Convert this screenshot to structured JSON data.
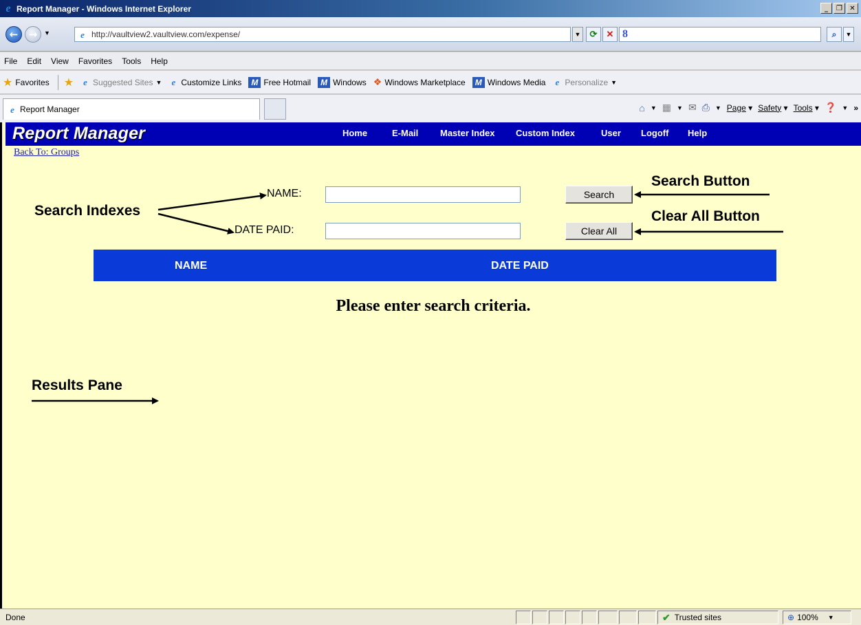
{
  "window": {
    "title": "Report Manager - Windows Internet Explorer",
    "controls": [
      "_",
      "ʕ",
      "X"
    ]
  },
  "address": {
    "url": "http://vaultview2.vaultview.com/expense/",
    "search_value": "8"
  },
  "menu": [
    "File",
    "Edit",
    "View",
    "Favorites",
    "Tools",
    "Help"
  ],
  "favorites": {
    "label": "Favorites",
    "items": [
      {
        "label": "Suggested Sites",
        "icon": "ie-icon",
        "muted": true,
        "dropdown": true
      },
      {
        "label": "Customize Links",
        "icon": "ie-icon"
      },
      {
        "label": "Free Hotmail",
        "icon": "msn-icon"
      },
      {
        "label": "Windows",
        "icon": "msn-icon"
      },
      {
        "label": "Windows Marketplace",
        "icon": "windows-flag-icon"
      },
      {
        "label": "Windows Media",
        "icon": "msn-icon"
      },
      {
        "label": "Personalize",
        "icon": "ie-icon",
        "muted": true,
        "dropdown": true
      }
    ]
  },
  "tab": {
    "label": "Report Manager"
  },
  "command_bar": {
    "page": "Page",
    "safety": "Safety",
    "tools": "Tools"
  },
  "app": {
    "logo": "Report Manager",
    "nav": [
      "Home",
      "E-Mail",
      "Master Index",
      "Custom Index",
      "User",
      "Logoff",
      "Help"
    ],
    "back_link": "Back To: Groups",
    "form": {
      "name_label": "NAME:",
      "name_value": "",
      "date_label": "DATE PAID:",
      "date_value": "",
      "search_button": "Search",
      "clear_button": "Clear All"
    },
    "results": {
      "columns": [
        "NAME",
        "DATE PAID"
      ],
      "message": "Please enter search criteria."
    }
  },
  "annotations": {
    "search_indexes": "Search Indexes",
    "search_button": "Search Button",
    "clear_all_button": "Clear All Button",
    "results_pane": "Results Pane"
  },
  "status": {
    "text": "Done",
    "zone": "Trusted sites",
    "zoom": "100%"
  },
  "colors": {
    "page_background": "#ffffcc",
    "header_bar": "#0000b4",
    "results_header": "#0a3bd8"
  }
}
